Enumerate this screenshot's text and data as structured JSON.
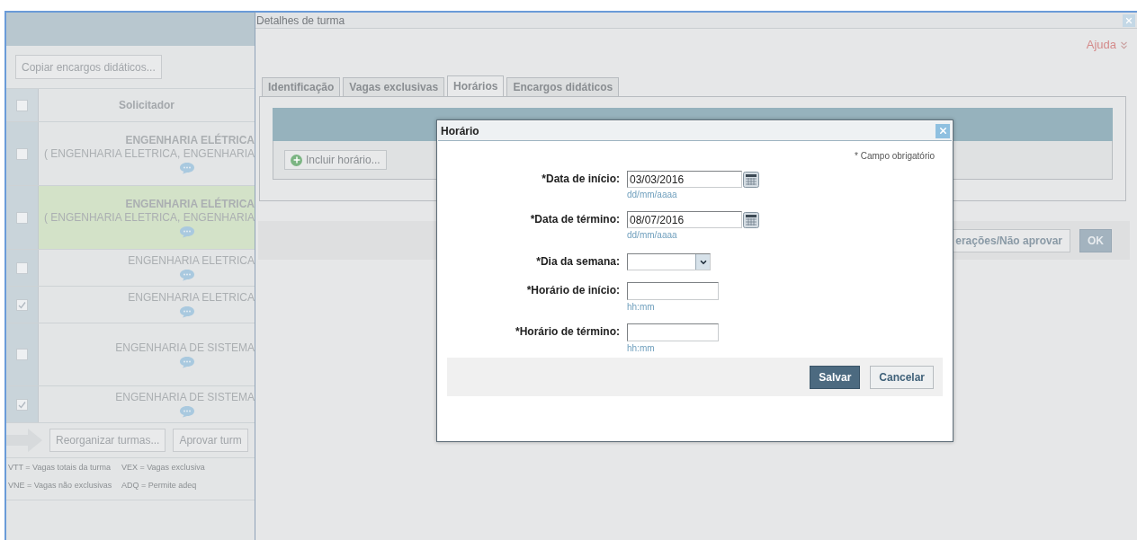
{
  "left_panel": {
    "copy_button": "Copiar encargos didáticos...",
    "table": {
      "columns": [
        "Solicitador"
      ],
      "header_checked": false,
      "rows": [
        {
          "kind": "detailed",
          "title": "ENGENHARIA ELÉTRICA",
          "subtitle": "( ENGENHARIA ELETRICA, ENGENHARIA",
          "checked": false,
          "selected": false
        },
        {
          "kind": "detailed",
          "title": "ENGENHARIA ELÉTRICA",
          "subtitle": "( ENGENHARIA ELETRICA, ENGENHARIA",
          "checked": false,
          "selected": true
        },
        {
          "kind": "simple",
          "title": "ENGENHARIA ELETRICA",
          "checked": false,
          "selected": false
        },
        {
          "kind": "simple",
          "title": "ENGENHARIA ELETRICA",
          "checked": true,
          "selected": false
        },
        {
          "kind": "tall",
          "title": "ENGENHARIA DE SISTEMA",
          "checked": false,
          "selected": false
        },
        {
          "kind": "simple",
          "title": "ENGENHARIA DE SISTEMA",
          "checked": true,
          "selected": false
        }
      ]
    },
    "actions": [
      "Reorganizar turmas...",
      "Aprovar turm"
    ],
    "legend": [
      "VTT = Vagas totais da turma",
      "VEX = Vagas exclusiva",
      "VNE = Vagas não exclusivas",
      "ADQ = Permite adeq"
    ]
  },
  "window": {
    "title": "Detalhes de turma",
    "help": "Ajuda",
    "tabs": [
      {
        "label": "Identificação",
        "selected": false
      },
      {
        "label": "Vagas exclusivas",
        "selected": false
      },
      {
        "label": "Horários",
        "selected": true
      },
      {
        "label": "Encargos didáticos",
        "selected": false
      }
    ],
    "include_button": "Incluir horário...",
    "footer_buttons": [
      {
        "label": "erações/Não aprovar",
        "kind": "secondary"
      },
      {
        "label": "OK",
        "kind": "primary"
      }
    ]
  },
  "dialog": {
    "title": "Horário",
    "required_note": "* Campo obrigatório",
    "fields": [
      {
        "kind": "date",
        "label": "*Data de início:",
        "value": "03/03/2016",
        "hint": "dd/mm/aaaa"
      },
      {
        "kind": "date",
        "label": "*Data de término:",
        "value": "08/07/2016",
        "hint": "dd/mm/aaaa"
      },
      {
        "kind": "select",
        "label": "*Dia da semana:"
      },
      {
        "kind": "text",
        "label": "*Horário de início:",
        "hint": "hh:mm"
      },
      {
        "kind": "text",
        "label": "*Horário de término:",
        "hint": "hh:mm"
      }
    ],
    "buttons": [
      {
        "label": "Salvar",
        "kind": "primary"
      },
      {
        "label": "Cancelar",
        "kind": "secondary"
      }
    ]
  }
}
